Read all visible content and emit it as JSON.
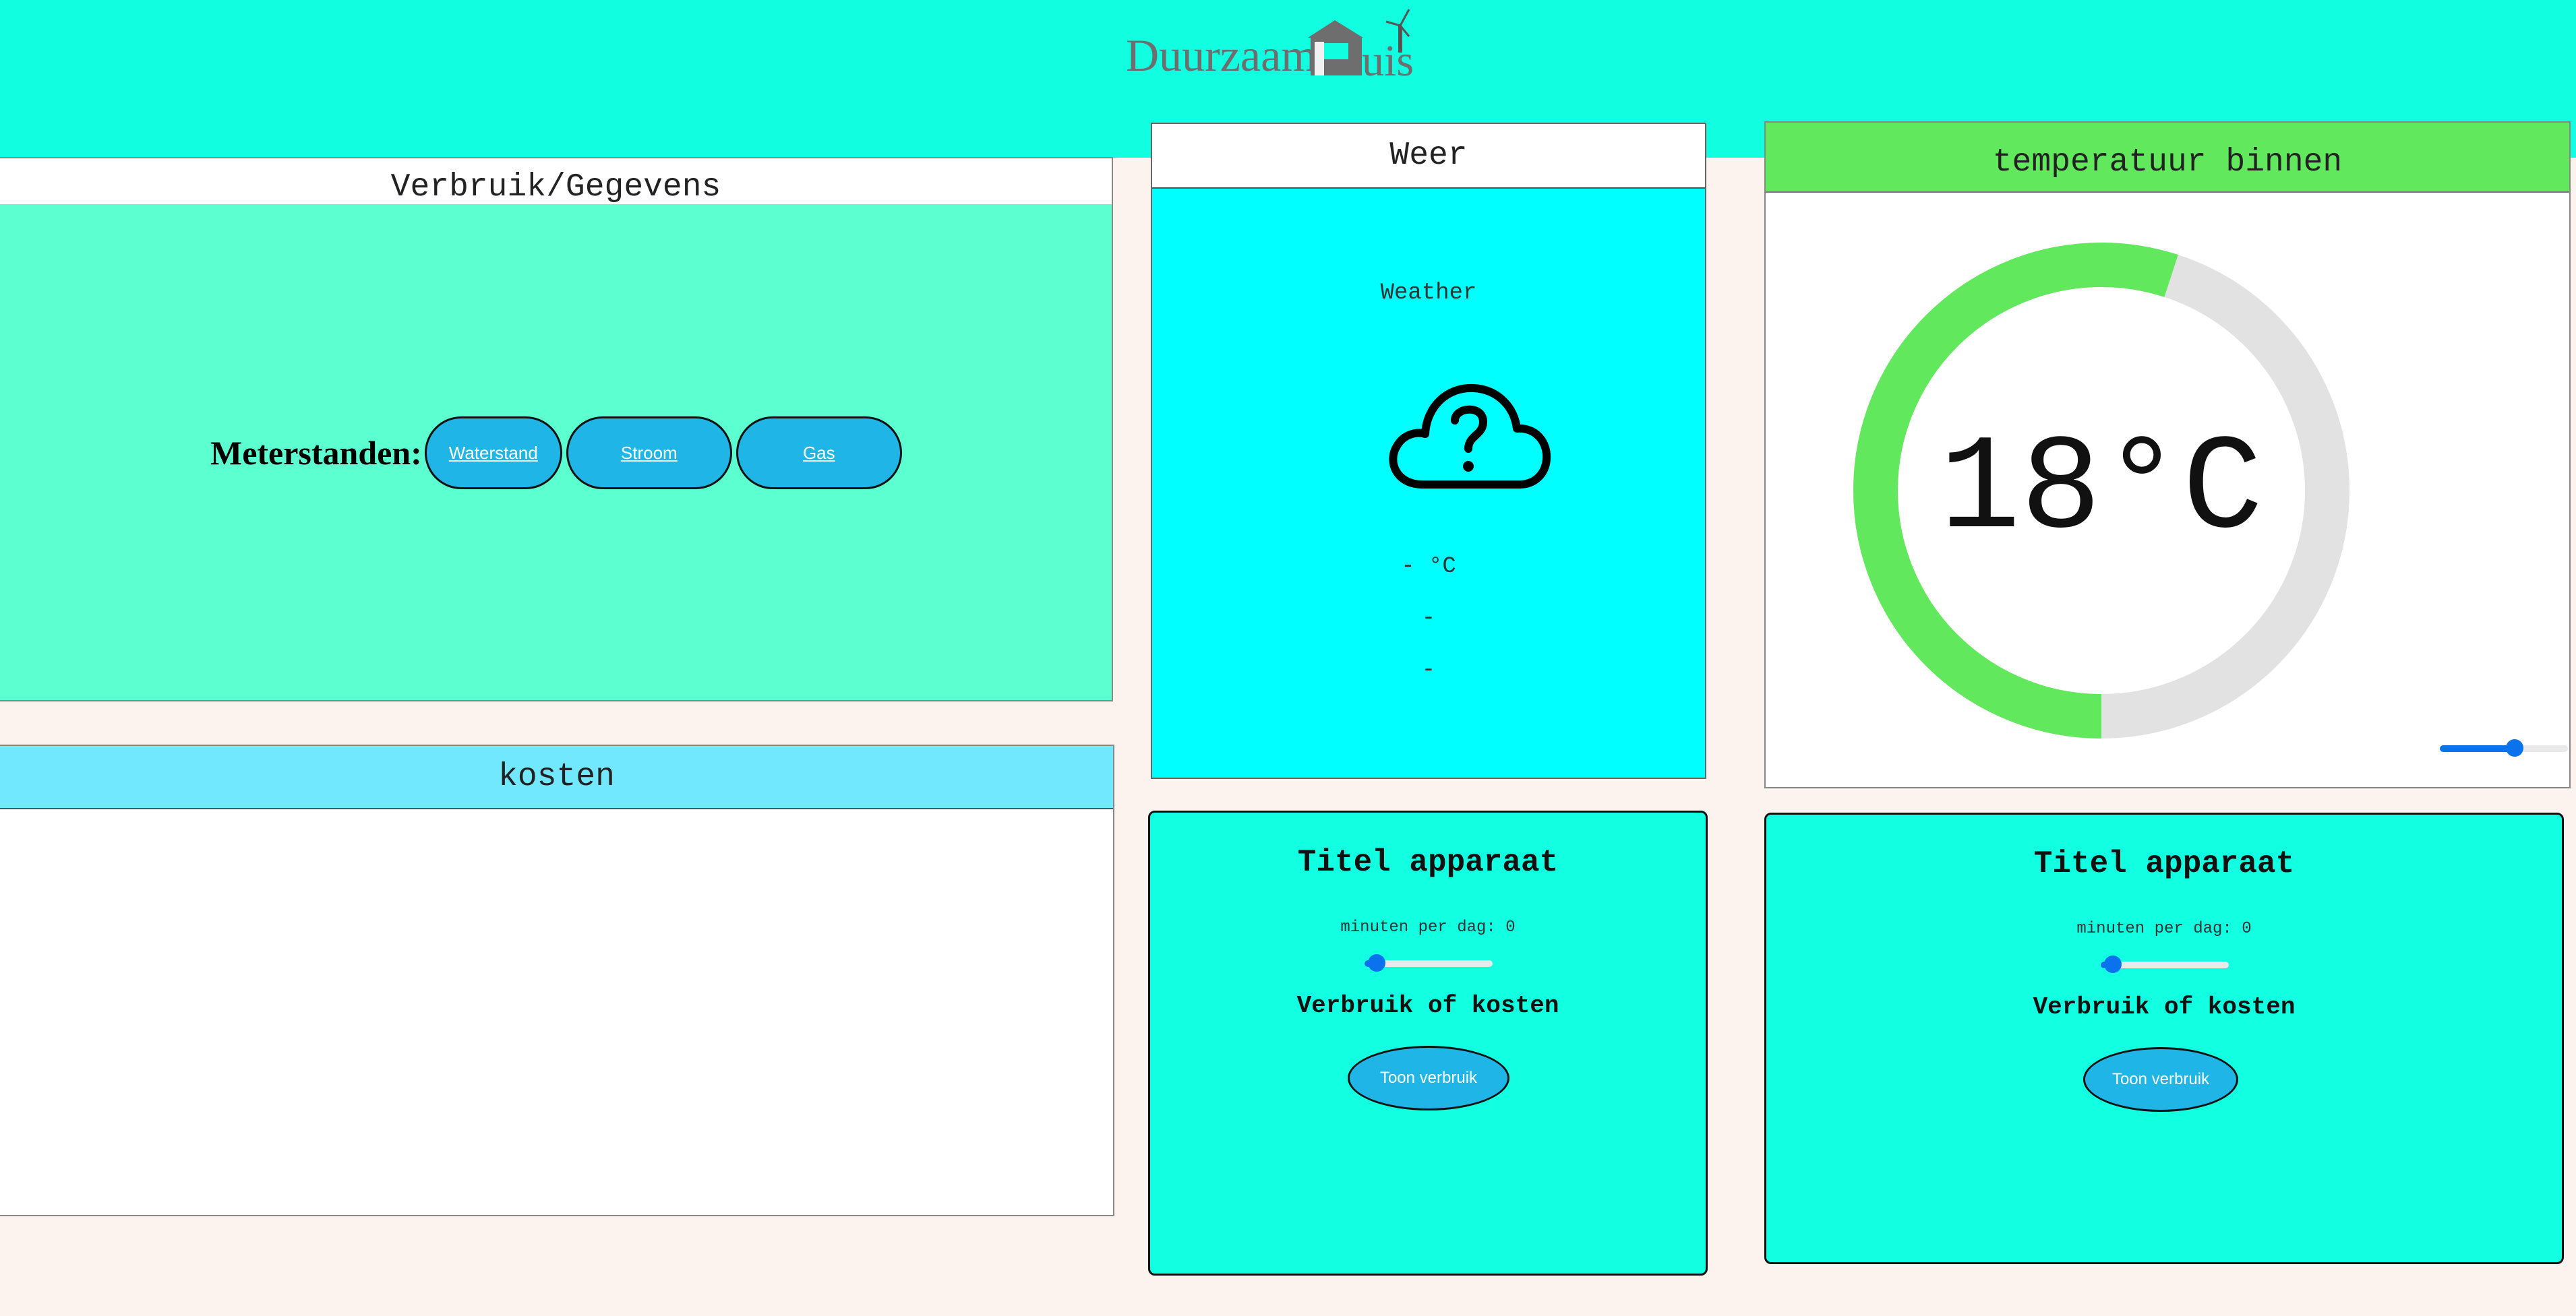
{
  "header": {
    "logo_text_part1": "Duurzaam",
    "logo_text_part2": "Huis"
  },
  "verbruik": {
    "title": "Verbruik/Gegevens",
    "meter_label": "Meterstanden:",
    "buttons": [
      "Waterstand",
      "Stroom",
      "Gas"
    ]
  },
  "kosten": {
    "title": "kosten"
  },
  "weer": {
    "title": "Weer",
    "subtitle": "Weather",
    "icon": "cloud-question-icon",
    "temperature": "- °C",
    "line2": "-",
    "line3": "-"
  },
  "temperatuur": {
    "title": "temperatuur binnen",
    "value": "18°C",
    "gauge_fraction": 0.55,
    "colors": {
      "gauge_fill": "#62e85c",
      "gauge_track": "#e2e2e2"
    }
  },
  "apparaten": [
    {
      "title": "Titel apparaat",
      "minutes_label": "minuten per dag: 0",
      "minutes": 0,
      "subtitle": "Verbruik of kosten",
      "button": "Toon verbruik"
    },
    {
      "title": "Titel apparaat",
      "minutes_label": "minuten per dag: 0",
      "minutes": 0,
      "subtitle": "Verbruik of kosten",
      "button": "Toon verbruik"
    }
  ],
  "colors": {
    "header_bg": "#12fee1",
    "button_bg": "#1fb5e6",
    "slider": "#0b72ee"
  }
}
